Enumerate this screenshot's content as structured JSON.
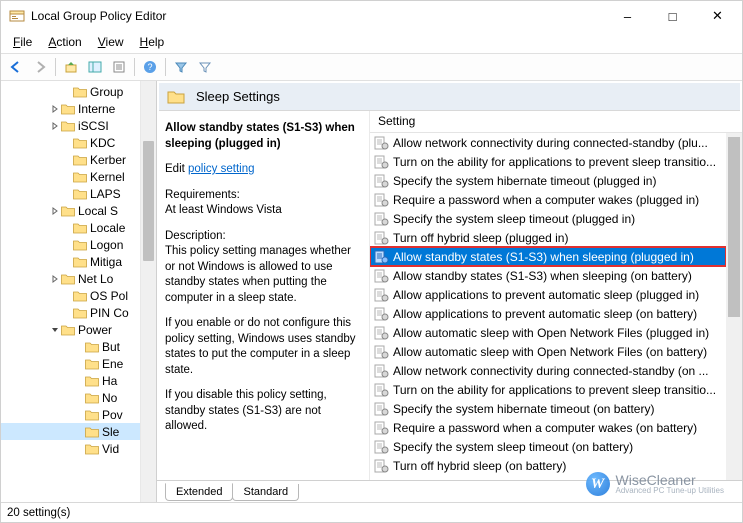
{
  "window": {
    "title": "Local Group Policy Editor"
  },
  "menus": {
    "file": "File",
    "action": "Action",
    "view": "View",
    "help": "Help"
  },
  "tree": {
    "items": [
      {
        "indent": 60,
        "tw": "",
        "label": "Group"
      },
      {
        "indent": 48,
        "tw": ">",
        "label": "Interne"
      },
      {
        "indent": 48,
        "tw": ">",
        "label": "iSCSI"
      },
      {
        "indent": 60,
        "tw": "",
        "label": "KDC"
      },
      {
        "indent": 60,
        "tw": "",
        "label": "Kerber"
      },
      {
        "indent": 60,
        "tw": "",
        "label": "Kernel"
      },
      {
        "indent": 60,
        "tw": "",
        "label": "LAPS"
      },
      {
        "indent": 48,
        "tw": ">",
        "label": "Local S"
      },
      {
        "indent": 60,
        "tw": "",
        "label": "Locale"
      },
      {
        "indent": 60,
        "tw": "",
        "label": "Logon"
      },
      {
        "indent": 60,
        "tw": "",
        "label": "Mitiga"
      },
      {
        "indent": 48,
        "tw": ">",
        "label": "Net Lo"
      },
      {
        "indent": 60,
        "tw": "",
        "label": "OS Pol"
      },
      {
        "indent": 60,
        "tw": "",
        "label": "PIN Co"
      },
      {
        "indent": 48,
        "tw": "v",
        "label": "Power"
      },
      {
        "indent": 72,
        "tw": "",
        "label": "But"
      },
      {
        "indent": 72,
        "tw": "",
        "label": "Ene"
      },
      {
        "indent": 72,
        "tw": "",
        "label": "Ha"
      },
      {
        "indent": 72,
        "tw": "",
        "label": "No"
      },
      {
        "indent": 72,
        "tw": "",
        "label": "Pov"
      },
      {
        "indent": 72,
        "tw": "",
        "label": "Sle",
        "sel": true
      },
      {
        "indent": 72,
        "tw": "",
        "label": "Vid"
      }
    ]
  },
  "header": {
    "title": "Sleep Settings"
  },
  "detail": {
    "title": "Allow standby states (S1-S3) when sleeping (plugged in)",
    "edit_label": "Edit ",
    "edit_link": "policy setting",
    "req_h": "Requirements:",
    "req_v": "At least Windows Vista",
    "desc_h": "Description:",
    "desc_1": "This policy setting manages whether or not Windows is allowed to use standby states when putting the computer in a sleep state.",
    "desc_2": "If you enable or do not configure this policy setting, Windows uses standby states to put the computer in a sleep state.",
    "desc_3": "If you disable this policy setting, standby states (S1-S3) are not allowed."
  },
  "list": {
    "column": "Setting",
    "items": [
      {
        "label": "Allow network connectivity during connected-standby (plu..."
      },
      {
        "label": "Turn on the ability for applications to prevent sleep transitio..."
      },
      {
        "label": "Specify the system hibernate timeout (plugged in)"
      },
      {
        "label": "Require a password when a computer wakes (plugged in)"
      },
      {
        "label": "Specify the system sleep timeout (plugged in)"
      },
      {
        "label": "Turn off hybrid sleep (plugged in)"
      },
      {
        "label": "Allow standby states (S1-S3) when sleeping (plugged in)",
        "sel": true
      },
      {
        "label": "Allow standby states (S1-S3) when sleeping (on battery)"
      },
      {
        "label": "Allow applications to prevent automatic sleep (plugged in)"
      },
      {
        "label": "Allow applications to prevent automatic sleep (on battery)"
      },
      {
        "label": "Allow automatic sleep with Open Network Files (plugged in)"
      },
      {
        "label": "Allow automatic sleep with Open Network Files (on battery)"
      },
      {
        "label": "Allow network connectivity during connected-standby (on ..."
      },
      {
        "label": "Turn on the ability for applications to prevent sleep transitio..."
      },
      {
        "label": "Specify the system hibernate timeout (on battery)"
      },
      {
        "label": "Require a password when a computer wakes (on battery)"
      },
      {
        "label": "Specify the system sleep timeout (on battery)"
      },
      {
        "label": "Turn off hybrid sleep (on battery)"
      }
    ]
  },
  "tabs": {
    "extended": "Extended",
    "standard": "Standard"
  },
  "status": {
    "text": "20 setting(s)"
  },
  "watermark": {
    "brand": "WiseCleaner",
    "sub": "Advanced PC Tune-up Utilities"
  }
}
